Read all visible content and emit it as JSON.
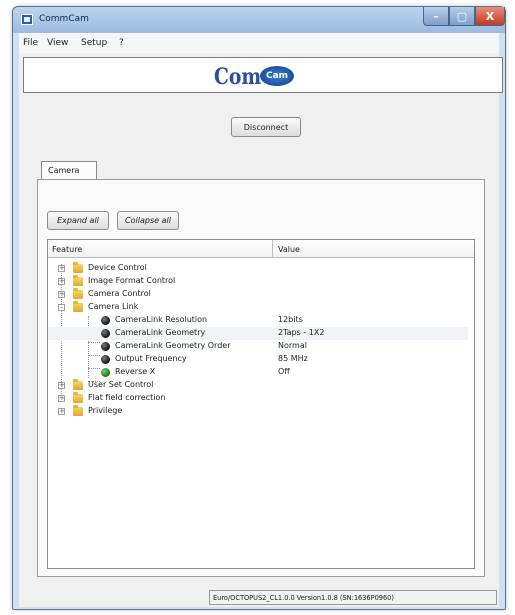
{
  "window": {
    "title": "CommCam"
  },
  "titlebar_buttons": {
    "minimize": "–",
    "maximize": "▢",
    "close": "X"
  },
  "menu": {
    "items": [
      "File",
      "View",
      "Setup",
      "?"
    ]
  },
  "logo": {
    "main": "Com",
    "sub": "Cam"
  },
  "toolbar": {
    "disconnect_label": "Disconnect"
  },
  "tabs": [
    {
      "label": "Camera"
    }
  ],
  "tree_controls": {
    "expand_label": "Expand all",
    "collapse_label": "Collapse all"
  },
  "tree": {
    "columns": {
      "feature": "Feature",
      "value": "Value"
    },
    "rows": [
      {
        "label": "Device Control",
        "icon": "folder-icon",
        "expander": "+"
      },
      {
        "label": "Image Format Control",
        "icon": "folder-icon",
        "expander": "+"
      },
      {
        "label": "Camera Control",
        "icon": "folder-icon",
        "expander": "+"
      },
      {
        "label": "Camera Link",
        "icon": "folder-icon",
        "expander": "–"
      },
      {
        "label": "CameraLink Resolution",
        "icon": "parameter-icon",
        "value": "12bits"
      },
      {
        "label": "CameraLink Geometry",
        "icon": "parameter-icon",
        "value": "2Taps - 1X2"
      },
      {
        "label": "CameraLink Geometry Order",
        "icon": "parameter-icon",
        "value": "Normal"
      },
      {
        "label": "Output Frequency",
        "icon": "parameter-icon",
        "value": "85 MHz"
      },
      {
        "label": "Reverse X",
        "icon": "parameter-green-icon",
        "value": "Off"
      },
      {
        "label": "User Set Control",
        "icon": "folder-icon",
        "expander": "+"
      },
      {
        "label": "Flat field correction",
        "icon": "folder-icon",
        "expander": "+"
      },
      {
        "label": "Privilege",
        "icon": "folder-icon",
        "expander": "+"
      }
    ]
  },
  "status": {
    "text": "Euro/OCTOPUS2_CL1.0.0 Version1.0.8 (SN:1636P0960)"
  },
  "colors": {
    "title_bar": "#9bbbe0",
    "close_button": "#c23b22",
    "logo_blue": "#2a4f9e"
  }
}
